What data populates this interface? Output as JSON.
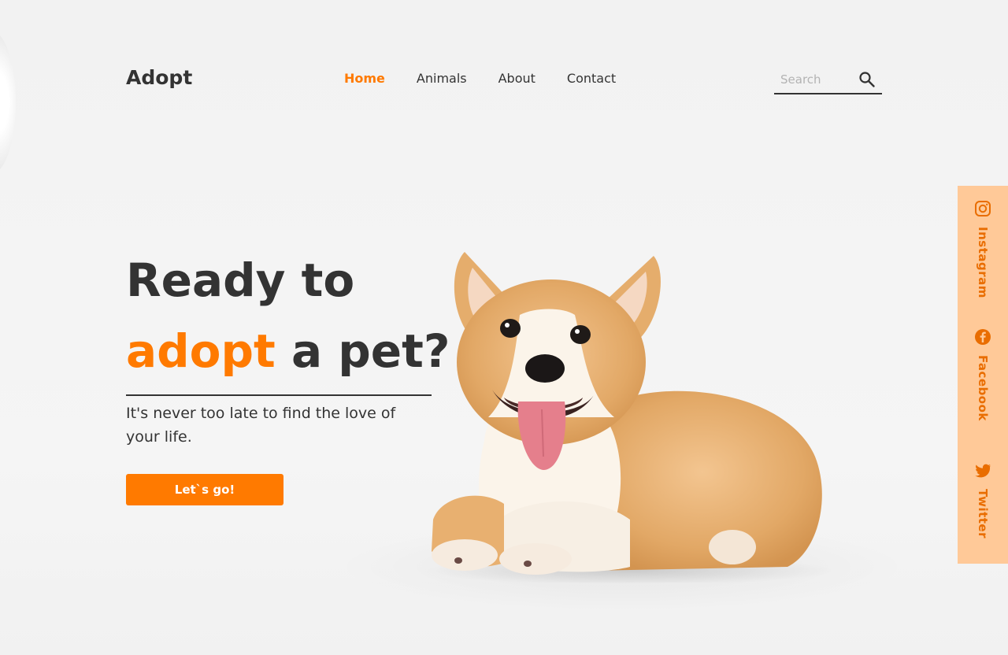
{
  "brand": {
    "name": "Adopt"
  },
  "nav": {
    "items": [
      {
        "label": "Home",
        "active": true
      },
      {
        "label": "Animals",
        "active": false
      },
      {
        "label": "About",
        "active": false
      },
      {
        "label": "Contact",
        "active": false
      }
    ]
  },
  "search": {
    "placeholder": "Search",
    "value": ""
  },
  "hero": {
    "line1": "Ready to",
    "line2_accent": "adopt",
    "line2_rest": " a pet?",
    "tagline": "It's never too late to find the love of your life.",
    "cta_label": "Let`s go!"
  },
  "social": {
    "items": [
      {
        "label": "Instagram",
        "icon": "instagram-icon"
      },
      {
        "label": "Facebook",
        "icon": "facebook-icon"
      },
      {
        "label": "Twitter",
        "icon": "twitter-icon"
      }
    ]
  },
  "colors": {
    "accent": "#ff7a00",
    "sidebar_bg": "#ffc998",
    "sidebar_text": "#e96d00",
    "text": "#333333",
    "background": "#f3f3f3"
  }
}
